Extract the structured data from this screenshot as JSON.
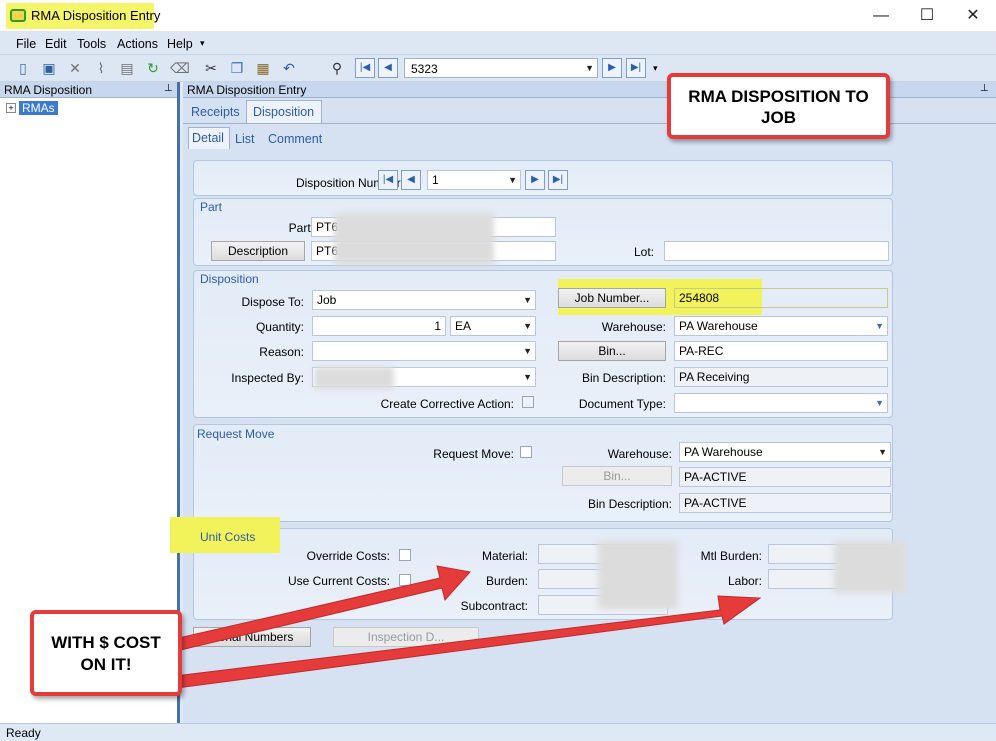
{
  "window": {
    "title": "RMA Disposition Entry",
    "minimize": "—",
    "maximize": "☐",
    "close": "✕"
  },
  "menu": [
    "File",
    "Edit",
    "Tools",
    "Actions",
    "Help"
  ],
  "toolbar": {
    "search_value": "5323"
  },
  "left_panel": {
    "header": "RMA Disposition",
    "tree_root": "RMAs"
  },
  "main": {
    "header": "RMA Disposition Entry",
    "tabs": [
      "Receipts",
      "Disposition"
    ],
    "subtabs": [
      "Detail",
      "List",
      "Comment"
    ],
    "disposition_number_label": "Disposition Number:",
    "disposition_number": "1",
    "part": {
      "group": "Part",
      "part_label": "Part:",
      "part_value": "PT6",
      "description_button": "Description",
      "description_value": "PT6",
      "lot_label": "Lot:"
    },
    "disposition": {
      "group": "Disposition",
      "dispose_to_label": "Dispose To:",
      "dispose_to": "Job",
      "quantity_label": "Quantity:",
      "quantity": "1",
      "uom": "EA",
      "reason_label": "Reason:",
      "inspected_by_label": "Inspected By:",
      "create_ca_label": "Create Corrective Action:",
      "job_number_button": "Job Number...",
      "job_number": "254808",
      "warehouse_label": "Warehouse:",
      "warehouse": "PA Warehouse",
      "bin_button": "Bin...",
      "bin": "PA-REC",
      "bin_desc_label": "Bin Description:",
      "bin_desc": "PA Receiving",
      "doc_type_label": "Document Type:"
    },
    "request_move": {
      "group": "Request Move",
      "request_move_label": "Request Move:",
      "warehouse_label": "Warehouse:",
      "warehouse": "PA Warehouse",
      "bin_button": "Bin...",
      "bin": "PA-ACTIVE",
      "bin_desc_label": "Bin Description:",
      "bin_desc": "PA-ACTIVE"
    },
    "unit_costs": {
      "group": "Unit Costs",
      "override_label": "Override Costs:",
      "use_current_label": "Use Current Costs:",
      "material_label": "Material:",
      "material": "1,",
      "burden_label": "Burden:",
      "subcontract_label": "Subcontract:",
      "mtl_burden_label": "Mtl Burden:",
      "labor_label": "Labor:",
      "labor": "1"
    },
    "serial_numbers_button": "Serial Numbers",
    "inspection_button": "Inspection D..."
  },
  "annotations": {
    "callout_top": "RMA DISPOSITION TO JOB",
    "callout_bottom": "WITH $ COST ON IT!",
    "callout_color": "#e53b3b",
    "highlight_color": "#f2f25a"
  },
  "status": "Ready"
}
